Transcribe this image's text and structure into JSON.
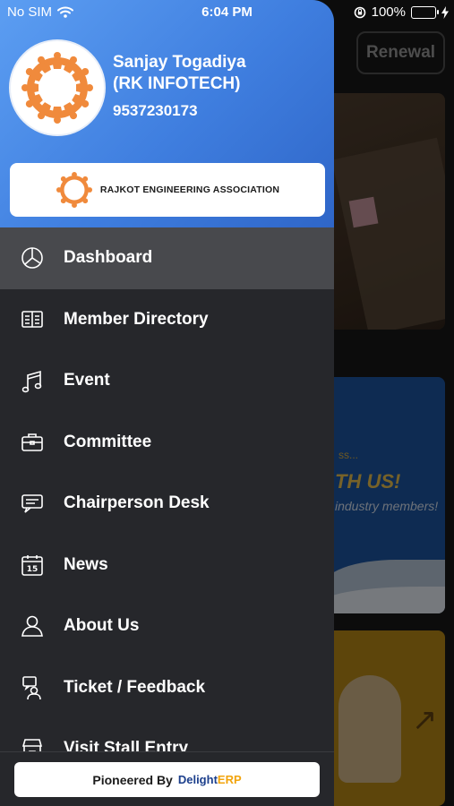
{
  "status_bar": {
    "carrier": "No SIM",
    "time": "6:04 PM",
    "battery": "100%",
    "icons": [
      "wifi-icon",
      "orientation-lock-icon",
      "battery-icon",
      "charging-icon"
    ]
  },
  "background": {
    "renewal_label": "Renewal",
    "banner_text_1": "ss...",
    "banner_text_2": "TH US!",
    "banner_text_3": "industry members!"
  },
  "drawer": {
    "user": {
      "name_line1": "Sanjay Togadiya",
      "name_line2": "(RK INFOTECH)",
      "phone": "9537230173"
    },
    "association_name": "RAJKOT ENGINEERING ASSOCIATION",
    "menu": [
      {
        "label": "Dashboard",
        "icon": "pie-chart-icon",
        "active": true
      },
      {
        "label": "Member Directory",
        "icon": "directory-book-icon",
        "active": false
      },
      {
        "label": "Event",
        "icon": "music-note-icon",
        "active": false
      },
      {
        "label": "Committee",
        "icon": "briefcase-icon",
        "active": false
      },
      {
        "label": "Chairperson Desk",
        "icon": "chat-bubble-icon",
        "active": false
      },
      {
        "label": "News",
        "icon": "calendar-icon",
        "active": false
      },
      {
        "label": "About Us",
        "icon": "user-icon",
        "active": false
      },
      {
        "label": "Ticket / Feedback",
        "icon": "support-agent-icon",
        "active": false
      },
      {
        "label": "Visit Stall Entry",
        "icon": "store-icon",
        "active": false
      }
    ],
    "footer": {
      "pioneered_by": "Pioneered By",
      "brand_part1": "Delight",
      "brand_part2": "ERP"
    }
  },
  "colors": {
    "header_gradient_start": "#5c9ef2",
    "header_gradient_end": "#2f66c8",
    "drawer_bg": "#26272b",
    "active_item_bg": "#48494d",
    "logo_orange": "#f08a3c"
  }
}
